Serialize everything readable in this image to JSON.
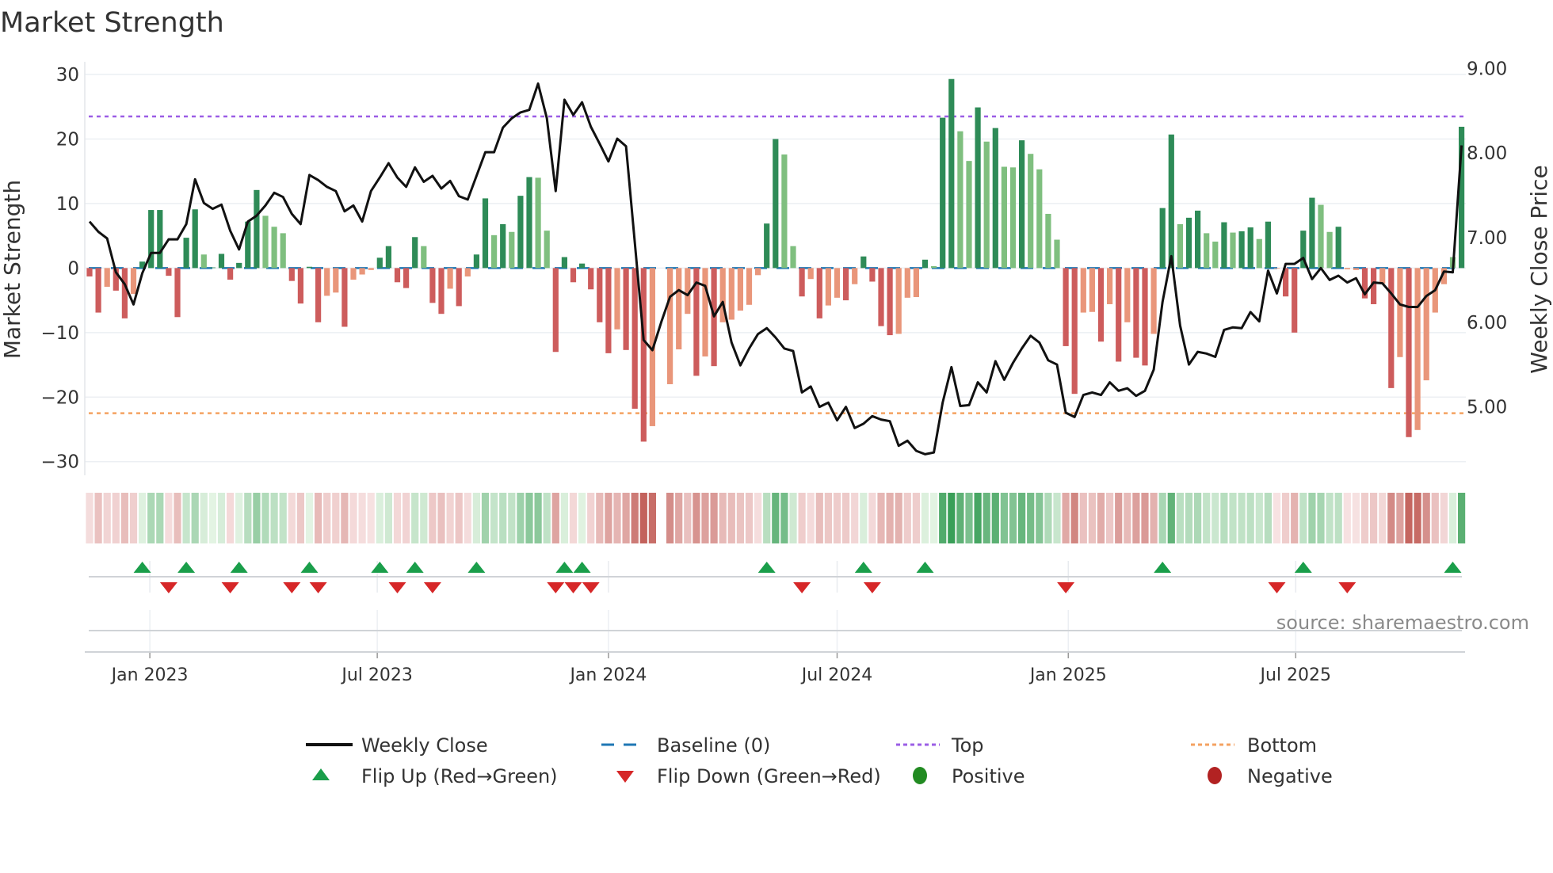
{
  "title": "Market Strength",
  "source": "source: sharemaestro.com",
  "colors": {
    "pos_strong": "#2e8b57",
    "pos_light": "#7fbf7f",
    "neg_strong": "#cd5c5c",
    "neg_light": "#e9967a",
    "line": "#111111",
    "baseline": "#1f77b4",
    "top": "#9b5de5",
    "bottom": "#f4a261",
    "flip_up": "#1a9e4a",
    "flip_down": "#d62728",
    "positive": "#228b22",
    "negative": "#b22222",
    "grid": "#eceff3"
  },
  "chart_data": {
    "type": "bar",
    "title": "Market Strength",
    "ylabel": "Market Strength",
    "y2label": "Weekly Close Price",
    "ylim": [
      -32,
      31.6
    ],
    "y2lim": [
      4.2,
      9.05
    ],
    "yticks": [
      30,
      20,
      10,
      0,
      -10,
      -20,
      -30
    ],
    "ytick_labels": [
      "30",
      "20",
      "10",
      "0",
      "−10",
      "−20",
      "−30"
    ],
    "y2ticks": [
      9,
      8,
      7,
      6,
      5
    ],
    "y2tick_labels": [
      "9.00",
      "8.00",
      "7.00",
      "6.00",
      "5.00"
    ],
    "x_start": "2022-11-14",
    "x_step_days": 7,
    "xticks": [
      {
        "date": "2023-01-01",
        "label": "Jan 2023"
      },
      {
        "date": "2023-07-01",
        "label": "Jul 2023"
      },
      {
        "date": "2024-01-01",
        "label": "Jan 2024"
      },
      {
        "date": "2024-07-01",
        "label": "Jul 2024"
      },
      {
        "date": "2025-01-01",
        "label": "Jan 2025"
      },
      {
        "date": "2025-07-01",
        "label": "Jul 2025"
      }
    ],
    "top": 23.5,
    "bottom": -22.5,
    "baseline": 0,
    "strength": [
      -1.3,
      -6.9,
      -2.9,
      -3.5,
      -7.8,
      -4.0,
      1.0,
      9.0,
      9.0,
      -1.2,
      -7.6,
      4.7,
      9.1,
      2.1,
      0.1,
      2.2,
      -1.8,
      0.8,
      7.2,
      12.1,
      8.1,
      6.4,
      5.4,
      -2.0,
      -5.5,
      0.2,
      -8.4,
      -4.3,
      -3.8,
      -9.1,
      -1.8,
      -1.0,
      -0.3,
      1.6,
      3.4,
      -2.2,
      -3.1,
      4.8,
      3.4,
      -5.4,
      -7.1,
      -3.2,
      -5.9,
      -1.3,
      2.1,
      10.8,
      5.1,
      6.8,
      5.6,
      11.2,
      14.1,
      14.0,
      5.8,
      -13.0,
      1.7,
      -2.2,
      0.7,
      -3.3,
      -8.4,
      -13.2,
      -9.5,
      -12.7,
      -21.8,
      -26.9,
      -24.5,
      null,
      -18.0,
      -12.6,
      -7.1,
      -16.7,
      -13.7,
      -15.2,
      -8.4,
      -8.0,
      -6.6,
      -5.7,
      -1.1,
      6.9,
      20.0,
      17.6,
      3.4,
      -4.4,
      -1.7,
      -7.8,
      -5.8,
      -4.6,
      -5.0,
      -2.5,
      1.8,
      -2.1,
      -9.0,
      -10.4,
      -10.2,
      -4.6,
      -4.5,
      1.3,
      0.3,
      23.3,
      29.3,
      21.2,
      16.6,
      24.9,
      19.6,
      21.7,
      15.7,
      15.6,
      19.8,
      17.7,
      15.3,
      8.4,
      4.4,
      -12.1,
      -19.5,
      -6.9,
      -6.8,
      -11.4,
      -5.6,
      -14.5,
      -8.4,
      -13.9,
      -15.1,
      -10.2,
      9.3,
      20.7,
      6.8,
      7.8,
      8.9,
      5.4,
      4.1,
      7.1,
      5.5,
      5.7,
      6.3,
      4.5,
      7.2,
      -0.1,
      -4.4,
      -10.0,
      5.8,
      10.9,
      9.8,
      5.6,
      6.4,
      -0.2,
      -0.3,
      -4.7,
      -5.6,
      -2.4,
      -18.6,
      -13.8,
      -26.2,
      -25.1,
      -17.4,
      -6.9,
      -2.5,
      1.7,
      21.9
    ],
    "shade_strong": [
      1,
      1,
      0,
      1,
      1,
      0,
      1,
      1,
      1,
      1,
      1,
      1,
      1,
      0,
      1,
      1,
      1,
      1,
      1,
      1,
      0,
      0,
      0,
      1,
      1,
      1,
      1,
      0,
      0,
      1,
      0,
      0,
      0,
      1,
      1,
      1,
      1,
      1,
      0,
      1,
      1,
      0,
      1,
      0,
      1,
      1,
      0,
      1,
      0,
      1,
      1,
      0,
      0,
      1,
      1,
      1,
      1,
      1,
      1,
      1,
      0,
      1,
      1,
      1,
      0,
      0,
      0,
      0,
      0,
      1,
      0,
      1,
      0,
      0,
      0,
      0,
      0,
      1,
      1,
      0,
      0,
      1,
      0,
      1,
      0,
      0,
      1,
      0,
      1,
      1,
      1,
      1,
      0,
      0,
      0,
      1,
      0,
      1,
      1,
      0,
      0,
      1,
      0,
      1,
      0,
      0,
      1,
      0,
      0,
      0,
      0,
      1,
      1,
      0,
      0,
      1,
      0,
      1,
      0,
      1,
      1,
      0,
      1,
      1,
      0,
      1,
      1,
      0,
      0,
      1,
      0,
      1,
      1,
      0,
      1,
      0,
      1,
      1,
      1,
      1,
      0,
      0,
      1,
      0,
      0,
      1,
      1,
      0,
      1,
      0,
      1,
      0,
      0,
      0,
      0,
      0,
      1
    ],
    "close": [
      7.19,
      7.07,
      6.99,
      6.59,
      6.45,
      6.21,
      6.58,
      6.82,
      6.82,
      6.98,
      6.98,
      7.16,
      7.69,
      7.41,
      7.34,
      7.39,
      7.08,
      6.86,
      7.19,
      7.26,
      7.38,
      7.53,
      7.48,
      7.28,
      7.16,
      7.74,
      7.68,
      7.6,
      7.55,
      7.31,
      7.38,
      7.19,
      7.55,
      7.71,
      7.88,
      7.71,
      7.6,
      7.83,
      7.66,
      7.73,
      7.58,
      7.67,
      7.49,
      7.45,
      7.73,
      8.01,
      8.01,
      8.3,
      8.41,
      8.48,
      8.51,
      8.82,
      8.41,
      7.55,
      8.63,
      8.45,
      8.6,
      8.31,
      8.11,
      7.9,
      8.17,
      8.08,
      6.94,
      5.79,
      5.67,
      6.0,
      6.3,
      6.38,
      6.32,
      6.47,
      6.43,
      6.07,
      6.24,
      5.76,
      5.49,
      5.69,
      5.86,
      5.93,
      5.82,
      5.69,
      5.66,
      5.17,
      5.24,
      5.0,
      5.05,
      4.84,
      5.0,
      4.75,
      4.8,
      4.89,
      4.85,
      4.83,
      4.54,
      4.6,
      4.48,
      4.44,
      4.46,
      5.05,
      5.47,
      5.01,
      5.02,
      5.29,
      5.17,
      5.54,
      5.32,
      5.52,
      5.69,
      5.84,
      5.76,
      5.55,
      5.5,
      4.93,
      4.88,
      5.14,
      5.17,
      5.14,
      5.29,
      5.19,
      5.22,
      5.13,
      5.19,
      5.44,
      6.24,
      6.78,
      5.96,
      5.5,
      5.65,
      5.63,
      5.59,
      5.91,
      5.94,
      5.93,
      6.12,
      6.01,
      6.61,
      6.34,
      6.69,
      6.69,
      6.76,
      6.51,
      6.64,
      6.5,
      6.55,
      6.47,
      6.52,
      6.33,
      6.47,
      6.46,
      6.34,
      6.21,
      6.18,
      6.18,
      6.31,
      6.38,
      6.6,
      6.59,
      8.09
    ],
    "flip_up": [
      6,
      11,
      17,
      25,
      33,
      37,
      44,
      54,
      56,
      77,
      88,
      95,
      122,
      138,
      155
    ],
    "flip_down": [
      9,
      16,
      23,
      26,
      35,
      39,
      53,
      55,
      57,
      81,
      89,
      111,
      135,
      143
    ],
    "legend_position": "bottom",
    "legend": [
      {
        "label": "Weekly Close",
        "symbol": "line"
      },
      {
        "label": "Baseline (0)",
        "symbol": "dash"
      },
      {
        "label": "Top",
        "symbol": "dot-purple"
      },
      {
        "label": "Bottom",
        "symbol": "dot-orange"
      },
      {
        "label": "Flip Up (Red→Green)",
        "symbol": "tri-up"
      },
      {
        "label": "Flip Down (Green→Red)",
        "symbol": "tri-down"
      },
      {
        "label": "Positive",
        "symbol": "circle-green"
      },
      {
        "label": "Negative",
        "symbol": "circle-red"
      }
    ]
  }
}
